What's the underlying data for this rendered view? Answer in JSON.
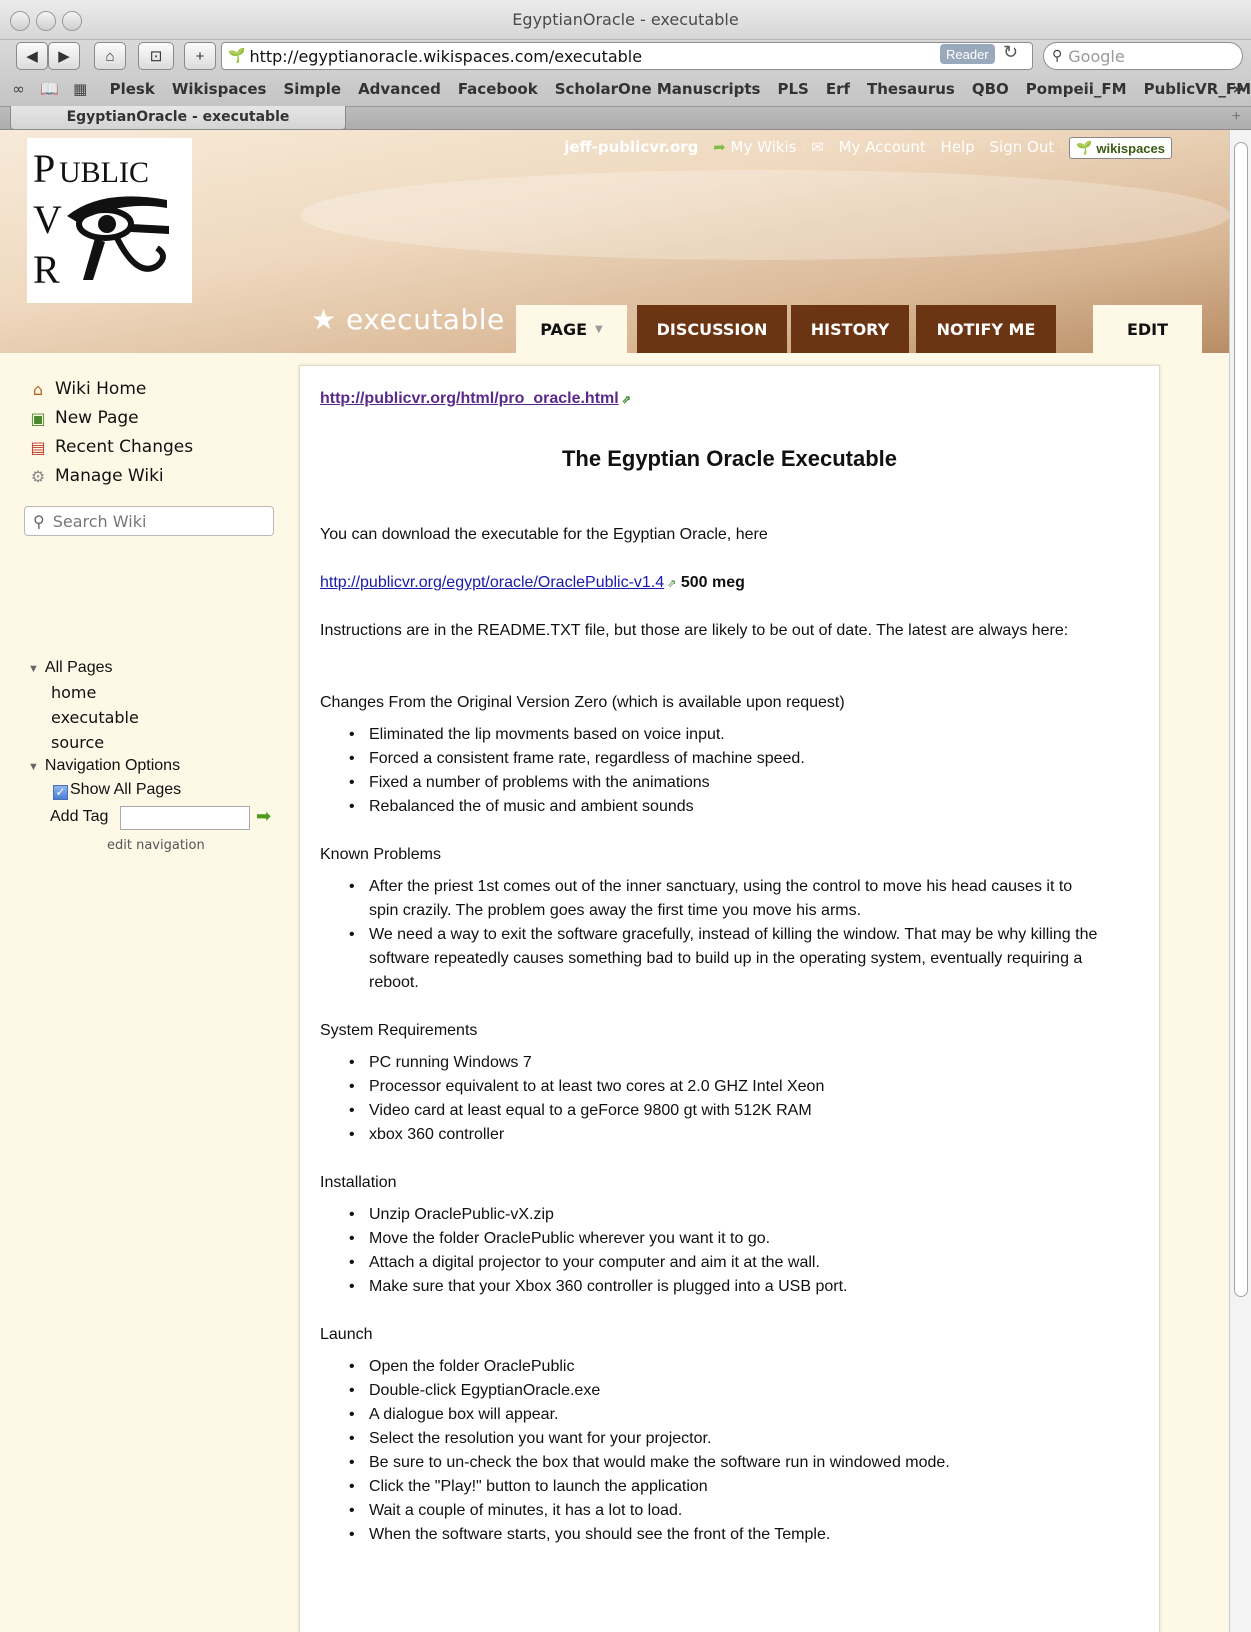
{
  "window": {
    "title": "EgyptianOracle - executable"
  },
  "toolbar": {
    "url": "http://egyptianoracle.wikispaces.com/executable",
    "reader_label": "Reader",
    "search_placeholder": "Google"
  },
  "bookmarks": [
    "Plesk",
    "Wikispaces",
    "Simple",
    "Advanced",
    "Facebook",
    "ScholarOne Manuscripts",
    "PLS",
    "Erf",
    "Thesaurus",
    "QBO",
    "Pompeii_FM",
    "PublicVR_FM"
  ],
  "tab": {
    "title": "EgyptianOracle - executable"
  },
  "header": {
    "logo_text": "PUBLIC VR",
    "user": "jeff-publicvr.org",
    "links": [
      "My Wikis",
      "My Account",
      "Help",
      "Sign Out"
    ],
    "badge": "wikispaces",
    "page_title": "executable",
    "tabs": {
      "page": "PAGE",
      "discussion": "DISCUSSION",
      "history": "HISTORY",
      "notify": "NOTIFY ME",
      "edit": "EDIT"
    }
  },
  "sidebar": {
    "items": [
      "Wiki Home",
      "New Page",
      "Recent Changes",
      "Manage Wiki"
    ],
    "search_placeholder": "Search Wiki",
    "all_pages": "All Pages",
    "pages": [
      "home",
      "executable",
      "source"
    ],
    "nav_options": "Navigation Options",
    "show_all": "Show All Pages",
    "add_tag": "Add Tag",
    "edit_nav": "edit navigation"
  },
  "content": {
    "top_link": "http://publicvr.org/html/pro_oracle.html",
    "title": "The Egyptian Oracle Executable",
    "intro": "You can download the executable for the Egyptian Oracle, here",
    "download_link": "http://publicvr.org/egypt/oracle/OraclePublic-v1.4",
    "download_size": "500 meg",
    "instructions": "Instructions are in the README.TXT file, but those are likely to be out of date. The latest are always here:",
    "changes_heading": "Changes From the Original Version Zero (which is available upon request)",
    "changes": [
      "Eliminated the lip movments based on voice input.",
      "Forced a consistent frame rate, regardless of machine speed.",
      "Fixed a number of problems with the animations",
      "Rebalanced the of music and ambient sounds"
    ],
    "problems_heading": "Known Problems",
    "problems": [
      [
        "After the priest 1st comes out of the inner sanctuary, using the control to move his head causes it to",
        "spin crazily. The problem goes away the first time you move his arms."
      ],
      [
        "We need a way to exit the software gracefully, instead of killing the window. That may be why killing the",
        "software repeatedly causes something bad to build up in the operating system, eventually requiring a",
        "reboot."
      ]
    ],
    "requirements_heading": "System Requirements",
    "requirements": [
      "PC running Windows 7",
      "Processor equivalent to at least two cores at 2.0 GHZ Intel Xeon",
      "Video card at least equal to a geForce 9800 gt with 512K RAM",
      "xbox 360 controller"
    ],
    "installation_heading": "Installation",
    "installation": [
      "Unzip OraclePublic-vX.zip",
      "Move the folder OraclePublic wherever you want it to go.",
      "Attach a digital projector to your computer and aim it at the wall.",
      "Make sure that your Xbox 360 controller is plugged into a USB port."
    ],
    "launch_heading": "Launch",
    "launch": [
      "Open the folder OraclePublic",
      "Double-click EgyptianOracle.exe",
      "A dialogue box will appear.",
      "Select the resolution you want for your projector.",
      "Be sure to un-check the box that would make the software run in windowed mode.",
      "Click the \"Play!\" button to launch the application",
      "Wait a couple of minutes, it has a lot to load.",
      "When the software starts, you should see the front of the Temple."
    ]
  }
}
